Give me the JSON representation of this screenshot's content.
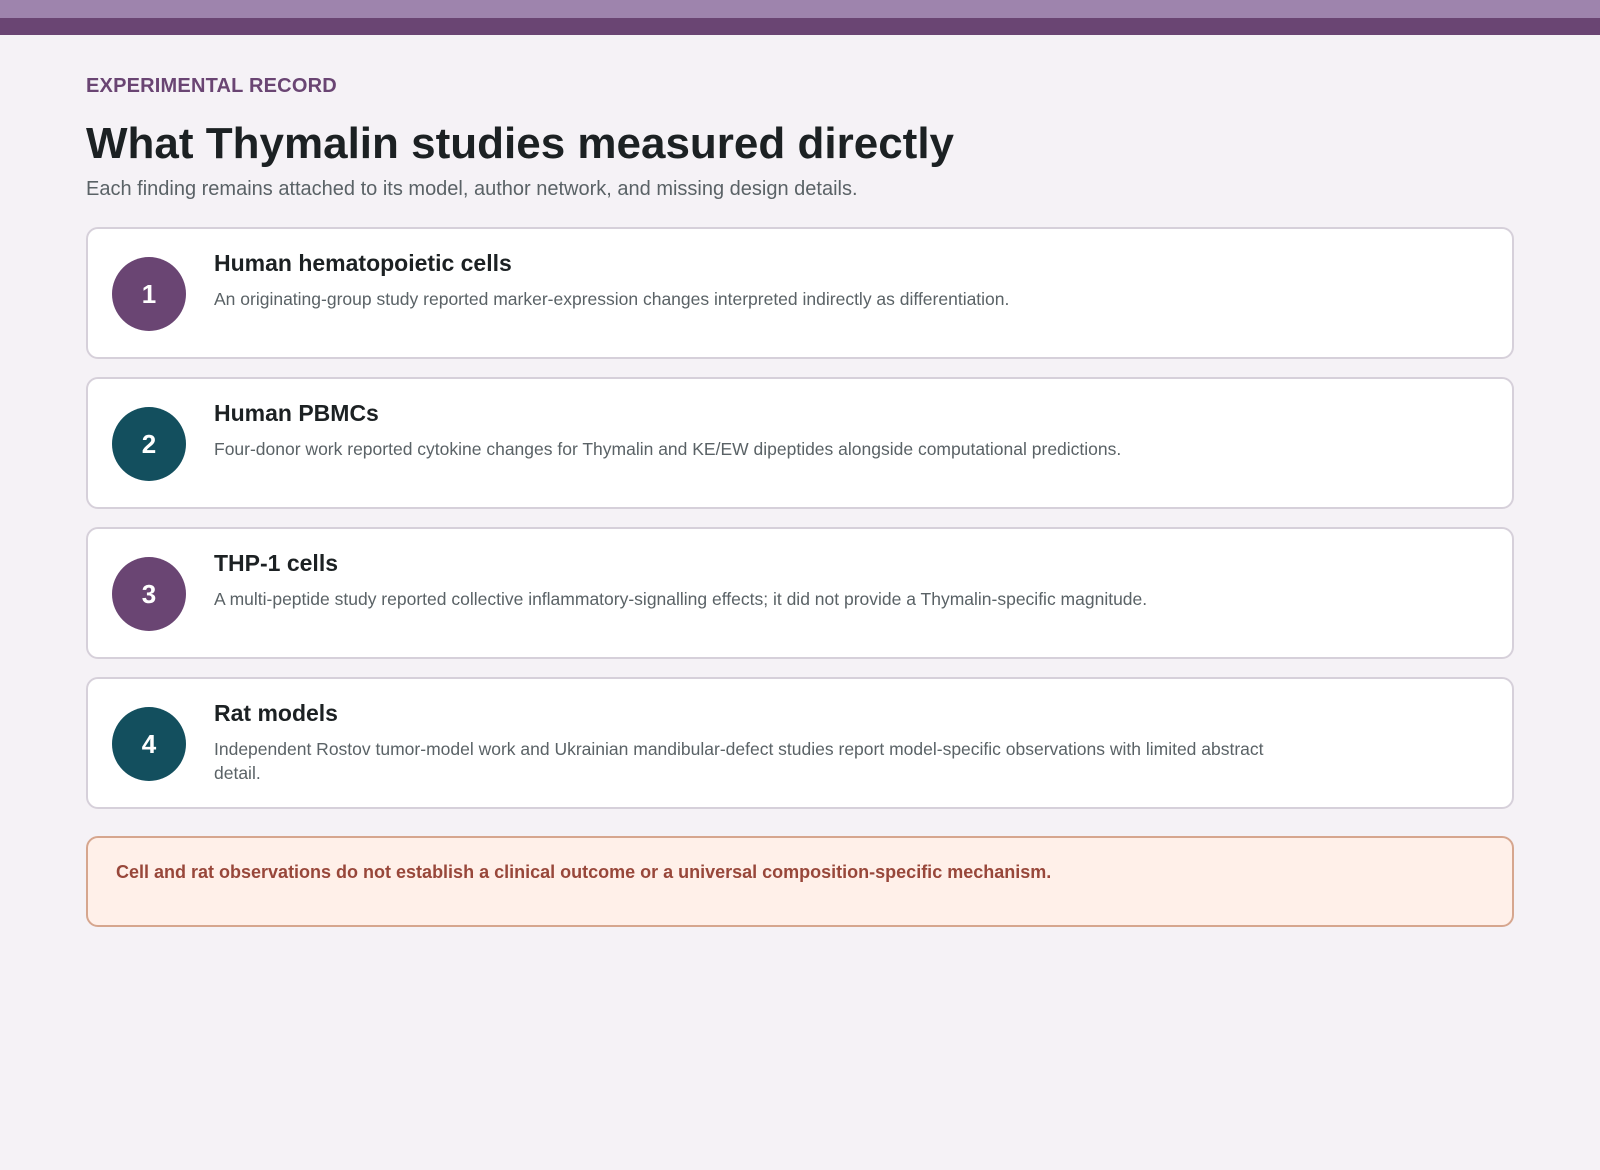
{
  "header": {
    "eyebrow": "EXPERIMENTAL RECORD",
    "title": "What Thymalin studies measured directly",
    "subtitle": "Each finding remains attached to its model, author network, and missing design details."
  },
  "findings": [
    {
      "number": "1",
      "title": "Human hematopoietic cells",
      "description": "An originating-group study reported marker-expression changes interpreted indirectly as differentiation.",
      "accent": "#6a4573"
    },
    {
      "number": "2",
      "title": "Human PBMCs",
      "description": "Four-donor work reported cytokine changes for Thymalin and KE/EW dipeptides alongside computational predictions.",
      "accent": "#134f5e"
    },
    {
      "number": "3",
      "title": "THP-1 cells",
      "description": "A multi-peptide study reported collective inflammatory-signalling effects; it did not provide a Thymalin-specific magnitude.",
      "accent": "#6a4573"
    },
    {
      "number": "4",
      "title": "Rat models",
      "description": "Independent Rostov tumor-model work and Ukrainian mandibular-defect studies report model-specific observations with limited abstract detail.",
      "accent": "#134f5e"
    }
  ],
  "note": {
    "text": "Cell and rat observations do not establish a clinical outcome or a universal composition-specific mechanism."
  },
  "colors": {
    "brand_purple": "#6a4573",
    "brand_teal": "#134f5e",
    "note_background": "#fff0e9",
    "note_text": "#98473a"
  }
}
